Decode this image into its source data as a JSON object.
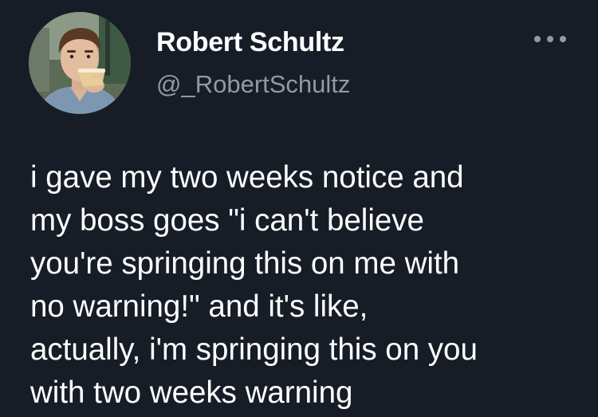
{
  "author": {
    "display_name": "Robert Schultz",
    "handle": "@_RobertSchultz"
  },
  "more_icon": "more-horizontal-icon",
  "tweet": {
    "lines": [
      "i gave my two weeks notice and",
      "my boss goes \"i can't believe",
      "you're springing this on me with",
      "no warning!\" and it's like,",
      "actually, i'm springing this on you",
      "with two weeks warning"
    ]
  },
  "colors": {
    "background": "#171d26",
    "text_primary": "#ffffff",
    "text_secondary": "#8f9aa6"
  }
}
